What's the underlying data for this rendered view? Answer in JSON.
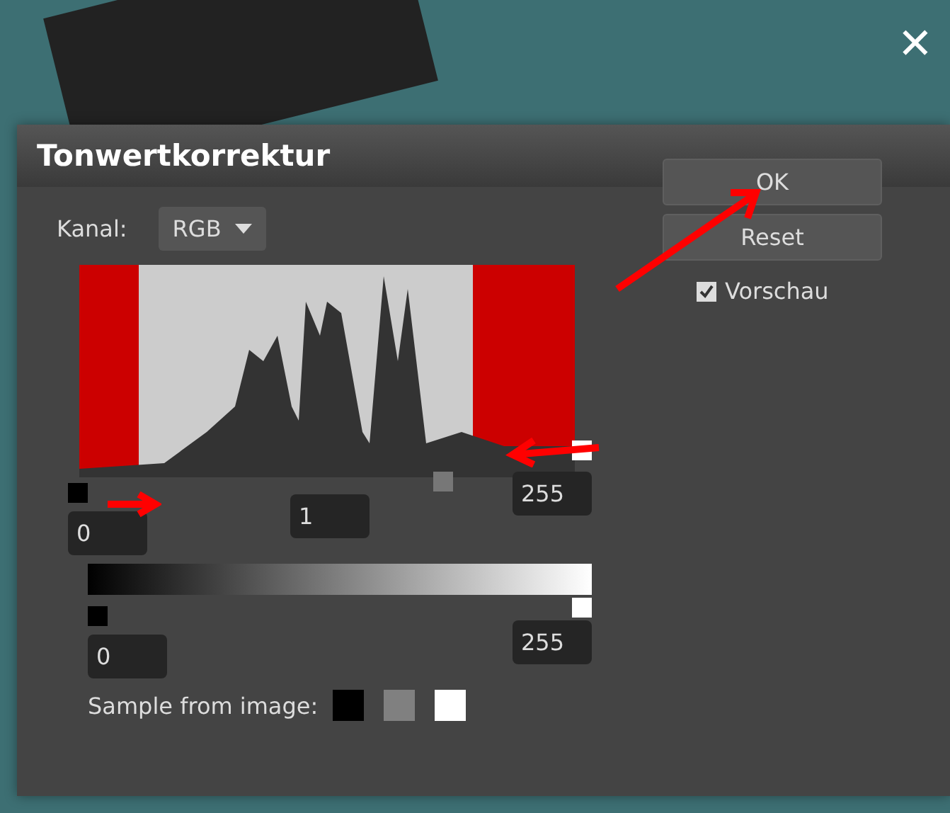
{
  "close_button": {
    "label": "✕"
  },
  "dialog": {
    "title": "Tonwertkorrektur",
    "channel": {
      "label": "Kanal:",
      "value": "RGB"
    },
    "input_levels": {
      "black": "0",
      "gamma": "1",
      "white": "255"
    },
    "output_levels": {
      "black": "0",
      "white": "255"
    },
    "sample": {
      "label": "Sample from image:",
      "swatches": [
        {
          "color": "#000000"
        },
        {
          "color": "#808080"
        },
        {
          "color": "#ffffff"
        }
      ]
    },
    "buttons": [
      {
        "label": "OK"
      },
      {
        "label": "Reset"
      }
    ],
    "preview": {
      "label": "Vorschau",
      "checked": true
    }
  }
}
